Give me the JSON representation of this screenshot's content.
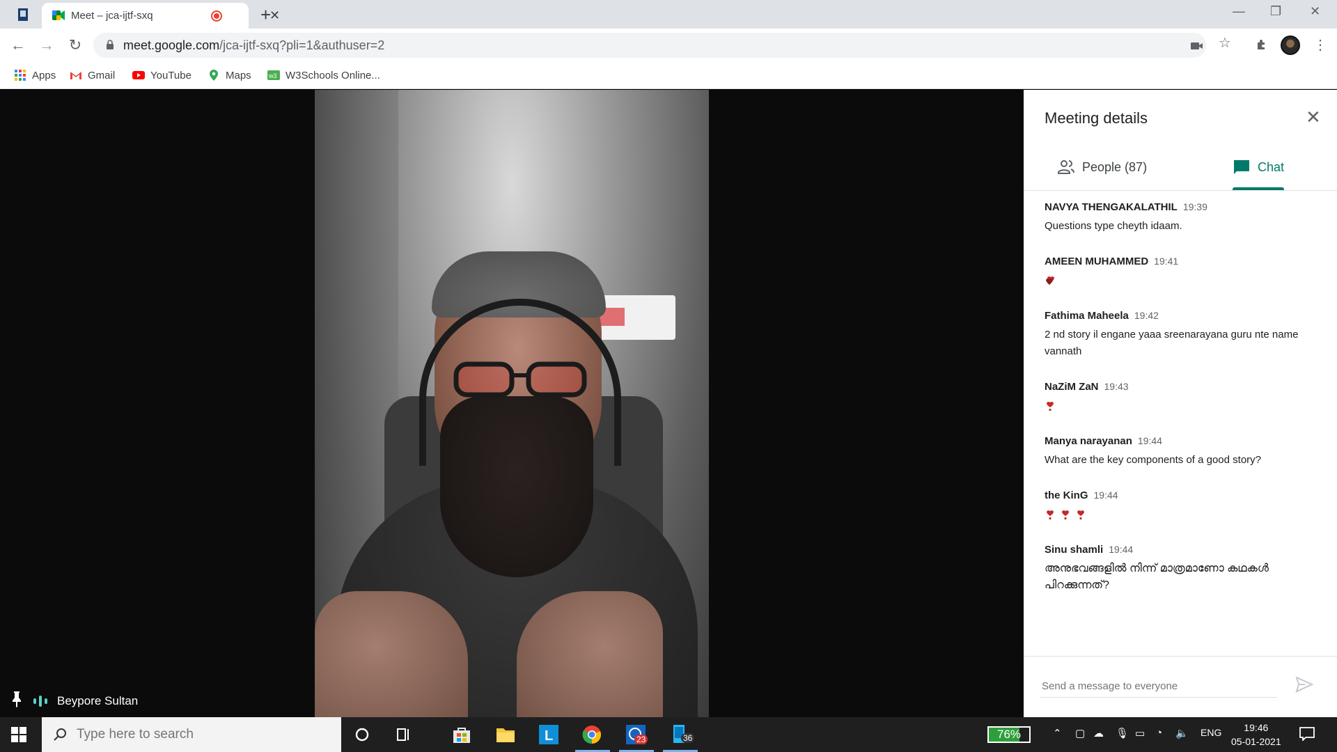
{
  "browser": {
    "tab_title": "Meet – jca-ijtf-sxq",
    "url_host": "meet.google.com",
    "url_path": "/jca-ijtf-sxq?pli=1&authuser=2",
    "bookmarks": [
      {
        "label": "Apps",
        "icon": "apps-grid-icon"
      },
      {
        "label": "Gmail",
        "icon": "gmail-icon"
      },
      {
        "label": "YouTube",
        "icon": "youtube-icon"
      },
      {
        "label": "Maps",
        "icon": "maps-icon"
      },
      {
        "label": "W3Schools Online...",
        "icon": "w3schools-icon"
      }
    ]
  },
  "meet": {
    "speaker_name": "Beypore Sultan",
    "panel_title": "Meeting details",
    "people_tab": "People (87)",
    "chat_tab": "Chat",
    "compose_placeholder": "Send a message to everyone",
    "messages": [
      {
        "sender": "NAVYA THENGAKALATHIL",
        "time": "19:39",
        "text": "Questions type cheyth idaam.",
        "hearts": 0
      },
      {
        "sender": "AMEEN MUHAMMED",
        "time": "19:41",
        "text": "",
        "hearts": 1,
        "heart_style": "double"
      },
      {
        "sender": "Fathima Maheela",
        "time": "19:42",
        "text": "2 nd story il engane yaaa sreenarayana guru nte name vannath",
        "hearts": 0
      },
      {
        "sender": "NaZiM ZaN",
        "time": "19:43",
        "text": "",
        "hearts": 1
      },
      {
        "sender": "Manya narayanan",
        "time": "19:44",
        "text": "What are the key components of a good story?",
        "hearts": 0
      },
      {
        "sender": "the KinG",
        "time": "19:44",
        "text": "",
        "hearts": 3
      },
      {
        "sender": "Sinu shamli",
        "time": "19:44",
        "text": "അനുഭവങ്ങളിൽ നിന്ന് മാത്രമാണോ കഥകൾ പിറക്കുന്നത്?",
        "hearts": 0
      }
    ]
  },
  "taskbar": {
    "search_placeholder": "Type here to search",
    "battery_percent": "76%",
    "battery_level": 0.76,
    "language": "ENG",
    "time": "19:46",
    "date": "05-01-2021",
    "whatsapp_badge": "23",
    "app_badge": "36"
  },
  "colors": {
    "accent": "#00796b",
    "heart": "#c62828",
    "taskbar": "#1f1f1f"
  }
}
